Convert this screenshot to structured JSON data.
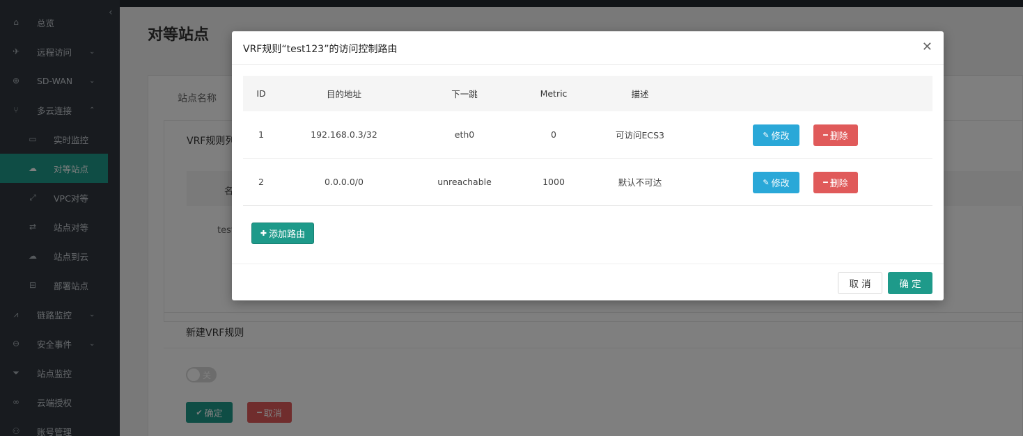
{
  "sidebar": {
    "collapse_icon": "chevron-left-icon",
    "items": [
      {
        "label": "总览",
        "icon": "home-icon",
        "glyph": "⌂",
        "has_arrow": false
      },
      {
        "label": "远程访问",
        "icon": "rocket-icon",
        "glyph": "✈",
        "has_arrow": true
      },
      {
        "label": "SD-WAN",
        "icon": "globe-icon",
        "glyph": "⊕",
        "has_arrow": true
      },
      {
        "label": "多云连接",
        "icon": "fork-icon",
        "glyph": "⑂",
        "has_arrow": true
      },
      {
        "label": "实时监控",
        "icon": "monitor-icon",
        "glyph": "▭"
      },
      {
        "label": "对等站点",
        "icon": "cloud-icon",
        "glyph": "☁"
      },
      {
        "label": "VPC对等",
        "icon": "expand-icon",
        "glyph": "⤢"
      },
      {
        "label": "站点对等",
        "icon": "sync-icon",
        "glyph": "⇄"
      },
      {
        "label": "站点到云",
        "icon": "cloud-upload-icon",
        "glyph": "☁"
      },
      {
        "label": "部署站点",
        "icon": "database-icon",
        "glyph": "⊟"
      },
      {
        "label": "链路监控",
        "icon": "chart-icon",
        "glyph": "⩘",
        "has_arrow": true
      },
      {
        "label": "安全事件",
        "icon": "minus-circle-icon",
        "glyph": "⊖",
        "has_arrow": true
      },
      {
        "label": "站点监控",
        "icon": "filter-icon",
        "glyph": "⏷"
      },
      {
        "label": "云端授权",
        "icon": "link-icon",
        "glyph": "∞"
      },
      {
        "label": "账号管理",
        "icon": "users-icon",
        "glyph": "⚇"
      }
    ]
  },
  "background": {
    "page_title": "对等站点",
    "tab_label": "站点名称",
    "vrf_list_title": "VRF规则列",
    "table_header_first": "名",
    "row_first": "test",
    "new_vrf_title": "新建VRF规则",
    "toggle_label": "关",
    "ok_label": "确定",
    "cancel_label": "取消"
  },
  "modal": {
    "title": "VRF规则“test123”的访问控制路由",
    "close_icon": "close-icon",
    "columns": [
      "ID",
      "目的地址",
      "下一跳",
      "Metric",
      "描述"
    ],
    "rows": [
      {
        "id": "1",
        "destination": "192.168.0.3/32",
        "next_hop": "eth0",
        "metric": "0",
        "description": "可访问ECS3"
      },
      {
        "id": "2",
        "destination": "0.0.0.0/0",
        "next_hop": "unreachable",
        "metric": "1000",
        "description": "默认不可达"
      }
    ],
    "edit_label": "修改",
    "delete_label": "删除",
    "add_route_label": "添加路由",
    "cancel_label": "取 消",
    "confirm_label": "确 定"
  }
}
